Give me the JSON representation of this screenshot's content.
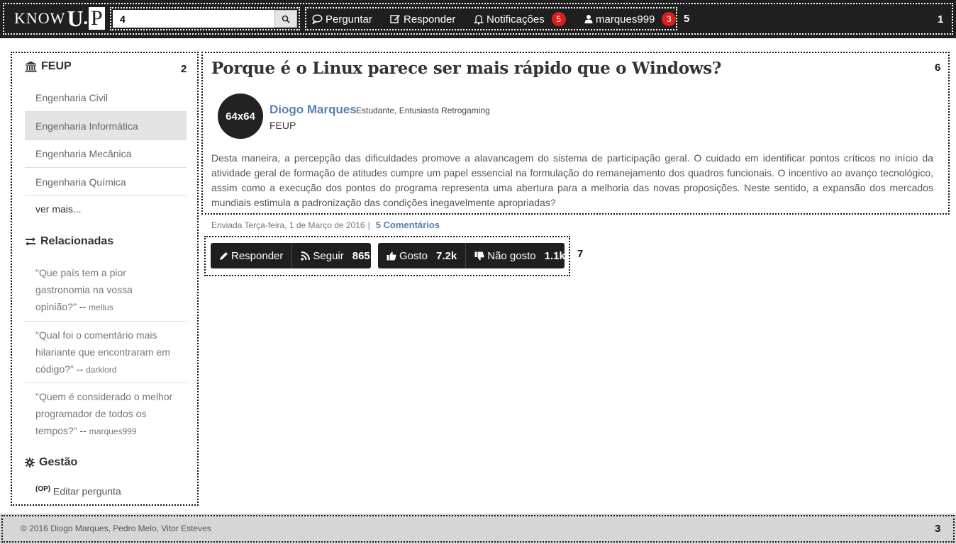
{
  "navbar": {
    "brand": {
      "know": "KNOW",
      "u": "U",
      "dot": ".",
      "p": "P"
    },
    "region_label": "1",
    "search": {
      "value": "4",
      "icon": "search-icon"
    },
    "links": [
      {
        "label": "Perguntar",
        "icon": "comment-icon"
      },
      {
        "label": "Responder",
        "icon": "edit-icon"
      },
      {
        "label": "Notificações",
        "icon": "bell-icon",
        "badge": "5"
      },
      {
        "label": "marques999",
        "icon": "user-icon",
        "badge": "3"
      }
    ],
    "links_region_label": "5"
  },
  "sidebar": {
    "region_label": "2",
    "section_title": "FEUP",
    "items": [
      "Engenharia Civil",
      "Engenharia Informática",
      "Engenharia Mecânica",
      "Engenharia Química"
    ],
    "more": "ver mais...",
    "related_title": "Relacionadas",
    "related": [
      {
        "line1": "\"Que país tem a pior",
        "line2": "gastronomia na vossa",
        "line3": "opinião?\"",
        "dash": " -- ",
        "author": "mellus"
      },
      {
        "line1": "\"Qual foi o comentário mais",
        "line2": "hilariante que encontraram em",
        "line3": "código?\"",
        "dash": " -- ",
        "author": "darklord"
      },
      {
        "line1": "\"Quem é considerado o melhor",
        "line2": "programador de todos os",
        "line3": "tempos?\"",
        "dash": " -- ",
        "author": "marques999"
      }
    ],
    "manage_title": "Gestão",
    "manage_tag": "(OP)",
    "manage_item": "Editar pergunta"
  },
  "question": {
    "region_label": "6",
    "title": "Porque é o Linux parece ser mais rápido que o Windows?",
    "avatar": "64x64",
    "author": "Diogo Marques",
    "author_desc": "Estudante, Entusiasta Retrogaming",
    "author_org": "FEUP",
    "body": "Desta maneira, a percepção das dificuldades promove a alavancagem do sistema de participação geral. O cuidado em identificar pontos críticos no início da atividade geral de formação de atitudes cumpre um papel essencial na formulação do remanejamento dos quadros funcionais. O incentivo ao avanço tecnológico, assim como a execução dos pontos do programa representa uma abertura para a melhoria das novas proposições. Neste sentido, a expansão dos mercados mundiais estimula a padronização das condições inegavelmente apropriadas?",
    "meta_date": "Enviada Terça-feira, 1 de Março de 2016",
    "meta_sep": "|",
    "meta_comments": "5 Comentários"
  },
  "actions": {
    "region_label": "7",
    "reply": "Responder",
    "follow": "Seguir",
    "follow_count": "865",
    "like": "Gosto",
    "like_count": "7.2k",
    "dislike": "Não gosto",
    "dislike_count": "1.1k"
  },
  "footer": {
    "text": "© 2016 Diogo Marques, Pedro Melo, Vitor Esteves",
    "region_label": "3"
  }
}
